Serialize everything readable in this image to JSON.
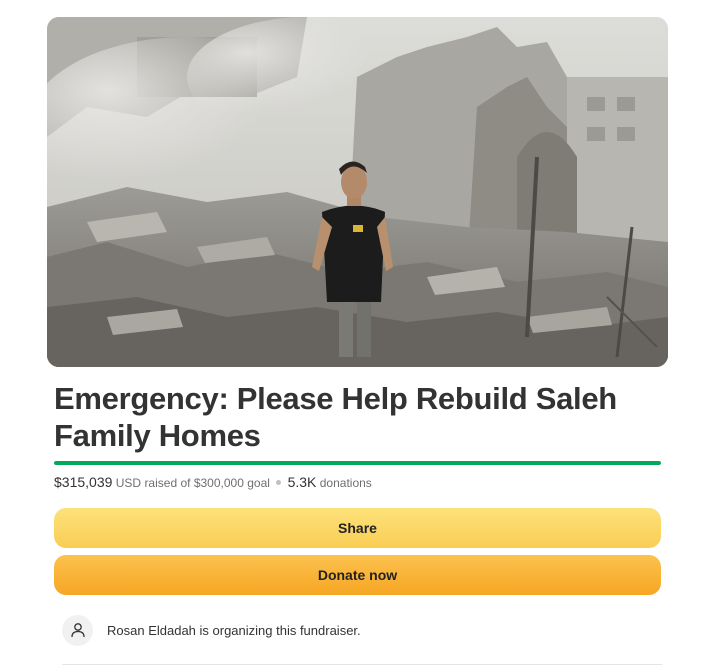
{
  "fundraiser": {
    "title": "Emergency: Please Help Rebuild Saleh Family Homes",
    "raised_amount": "$315,039",
    "currency": "USD",
    "raised_of_text": "raised of",
    "goal_amount": "$300,000",
    "goal_text": "goal",
    "donation_count": "5.3K",
    "donations_label": "donations",
    "progress_fraction": 1.0
  },
  "buttons": {
    "share_label": "Share",
    "donate_label": "Donate now"
  },
  "organizer": {
    "text": "Rosan Eldadah is organizing this fundraiser.",
    "avatar_icon": "person-icon"
  },
  "colors": {
    "progress": "#02a95c",
    "share_button": "#fbd667",
    "donate_button": "#f8b133"
  }
}
